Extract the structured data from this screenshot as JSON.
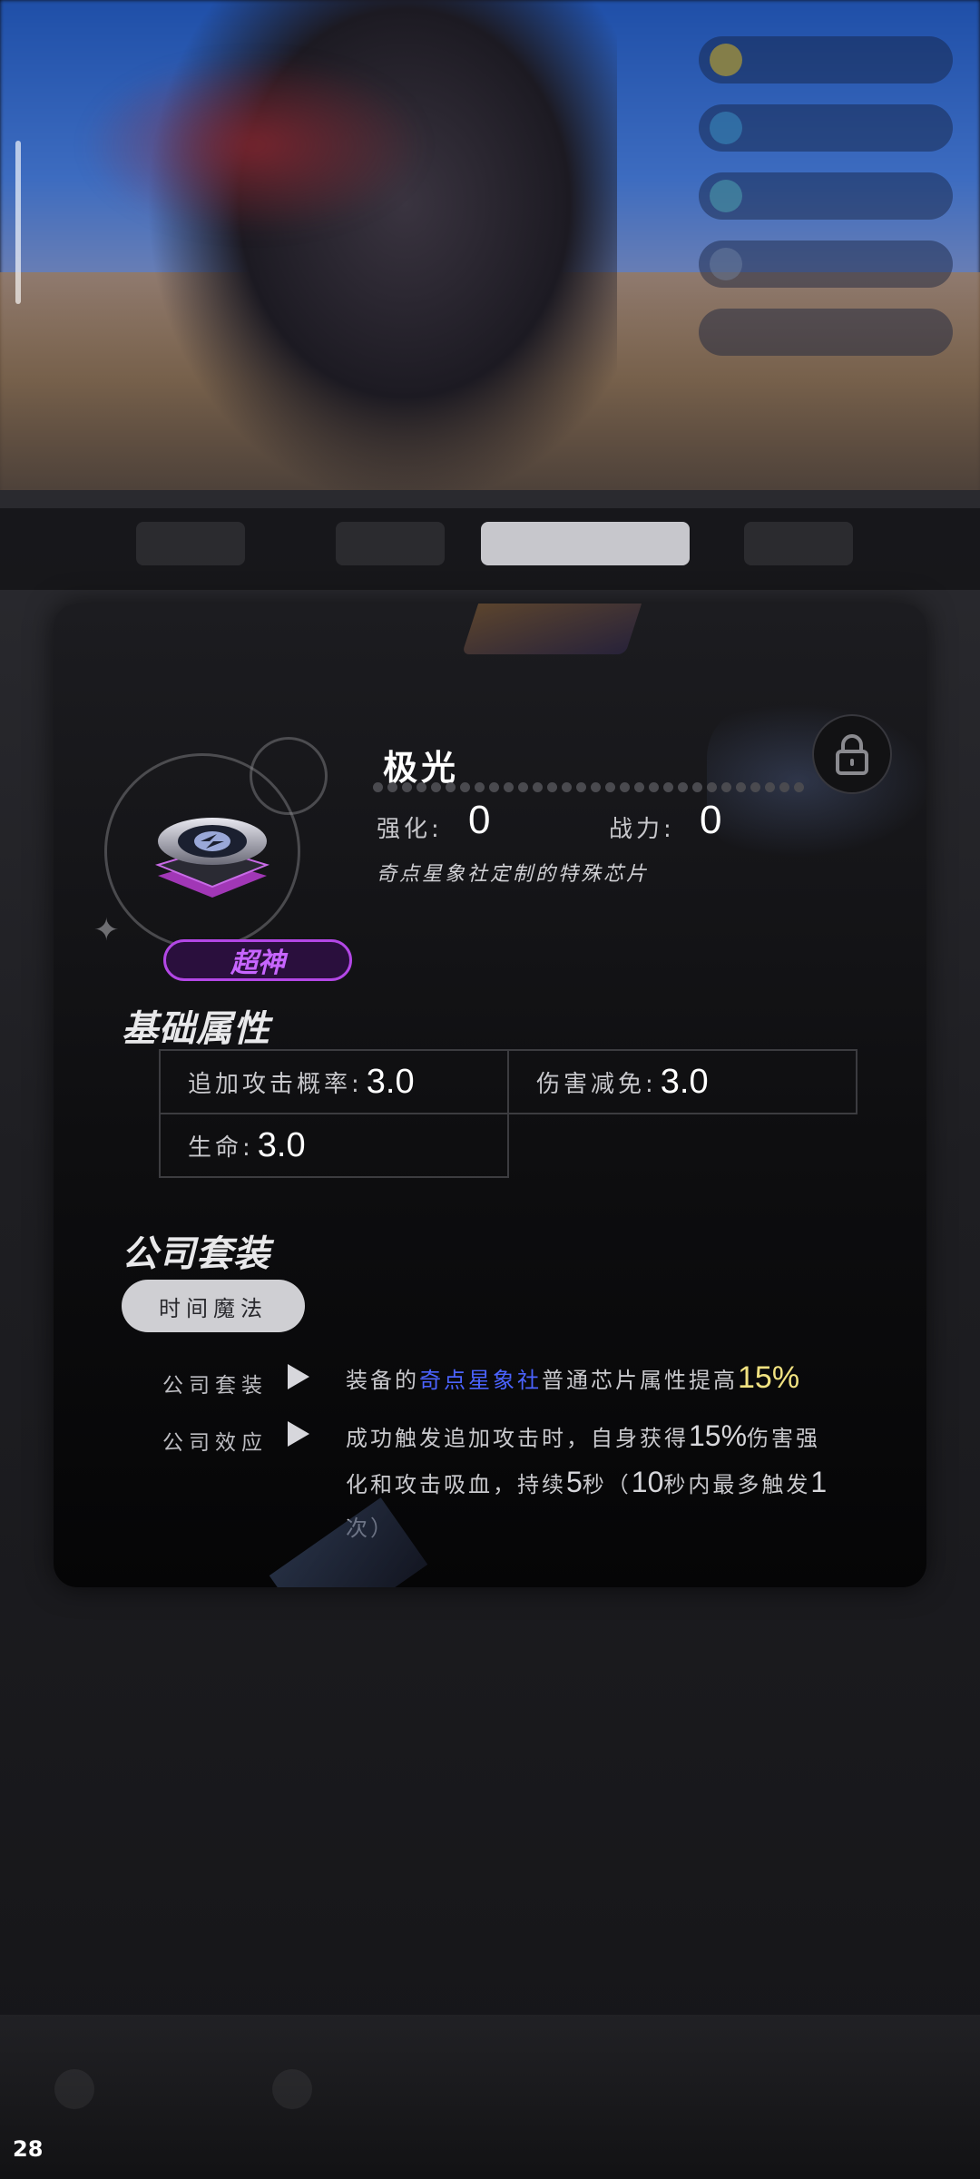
{
  "status": {
    "fps": "28"
  },
  "item": {
    "name": "极光",
    "rarity": "超神",
    "enhance_label": "强化:",
    "enhance_value": "0",
    "power_label": "战力:",
    "power_value": "0",
    "description": "奇点星象社定制的特殊芯片"
  },
  "base_attributes": {
    "title": "基础属性",
    "rows": [
      {
        "label": "追加攻击概率:",
        "value": "3.0"
      },
      {
        "label": "伤害减免:",
        "value": "3.0"
      },
      {
        "label": "生命:",
        "value": "3.0"
      }
    ]
  },
  "company_set": {
    "title": "公司套装",
    "set_name": "时间魔法",
    "bonus_1": {
      "label": "公司套装",
      "prefix": "装备的",
      "highlight": "奇点星象社",
      "middle": "普通芯片属性提高",
      "value": "15%"
    },
    "bonus_2": {
      "label": "公司效应",
      "line1_a": "成功触发追加攻击时，自身获得",
      "line1_num": "15%",
      "line1_b": "伤害强",
      "line2_a": "化和攻击吸血，持续",
      "line2_num1": "5",
      "line2_b": "秒（",
      "line2_num2": "10",
      "line2_c": "秒内最多触发",
      "line2_num3": "1",
      "line3": "次）"
    }
  },
  "colors": {
    "rarity": "#b347e6",
    "highlight_blue": "#4b63ff",
    "highlight_yellow": "#f1e281"
  },
  "icons": {
    "lock": "lock-icon",
    "play": "play-icon",
    "chip": "chip-icon"
  }
}
